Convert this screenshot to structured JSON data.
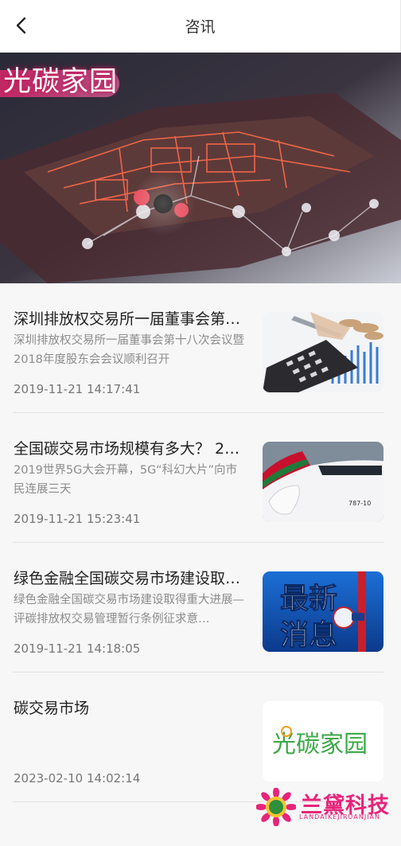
{
  "header": {
    "title": "咨讯",
    "back_icon": "chevron-left-icon"
  },
  "banner": {
    "overlay_text": "光碳家园"
  },
  "news": [
    {
      "title": "深圳排放权交易所一届董事会第…",
      "desc": "深圳排放权交易所一届董事会第十八次会议暨2018年度股东会会议顺利召开",
      "date": "2019-11-21 14:17:41",
      "thumb": "calculator-image"
    },
    {
      "title": "全国碳交易市场规模有多大？ 2…",
      "desc": "2019世界5G大会开幕，5G“科幻大片”向市民连展三天",
      "date": "2019-11-21 15:23:41",
      "thumb": "airplane-image"
    },
    {
      "title": "绿色金融全国碳交易市场建设取…",
      "desc": "绿色金融全国碳交易市场建设取得重大进展—评碳排放权交易管理暂行条例征求意…",
      "date": "2019-11-21 14:18:05",
      "thumb": "latest-news-image"
    },
    {
      "title": "碳交易市场",
      "desc": "",
      "date": "2023-02-10 14:02:14",
      "thumb": "guangtan-logo-image"
    }
  ],
  "thumb_text": {
    "latest_news": "最新消息",
    "news_line1": "最新",
    "news_line2": "消息",
    "model": "787-10",
    "guangtan": "光碳家园"
  },
  "watermark": {
    "name_cn": "兰黛科技",
    "name_en": "LANDAIKEJIRUANJIAN"
  }
}
